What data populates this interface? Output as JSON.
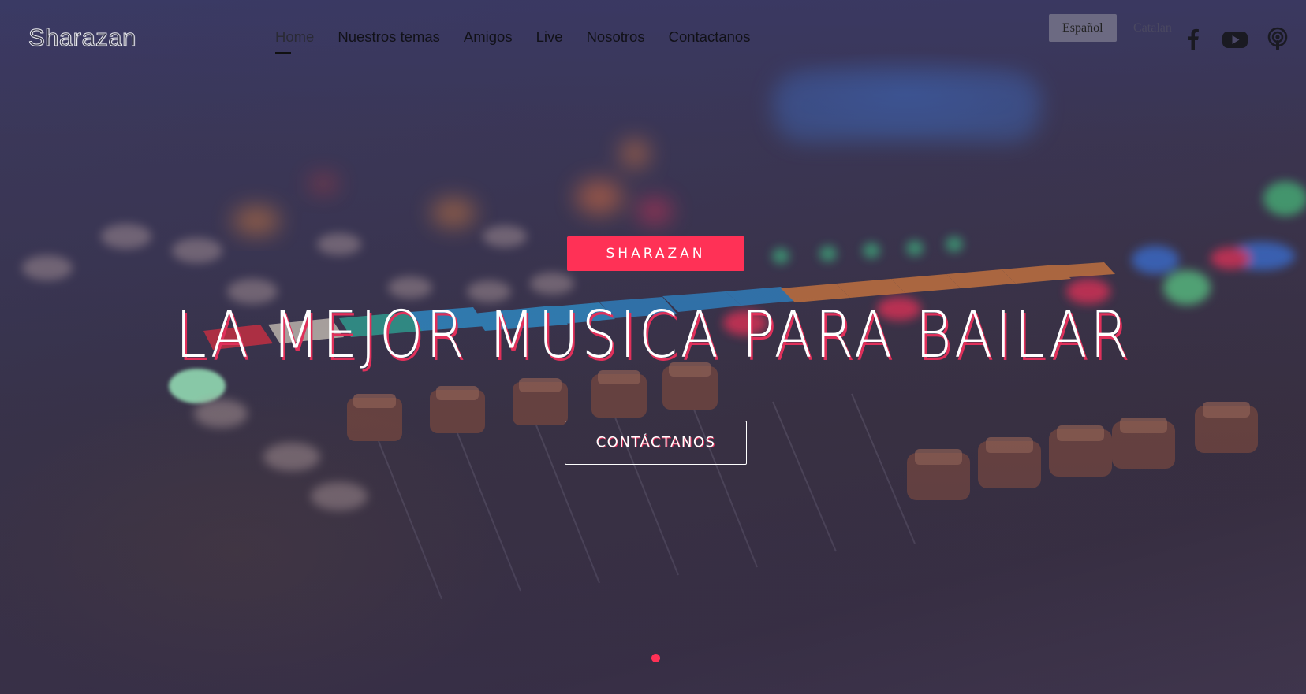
{
  "brand": {
    "name": "Sharazan"
  },
  "nav": {
    "items": [
      {
        "label": "Home",
        "active": true
      },
      {
        "label": "Nuestros temas"
      },
      {
        "label": "Amigos"
      },
      {
        "label": "Live"
      },
      {
        "label": "Nosotros"
      },
      {
        "label": "Contactanos"
      }
    ]
  },
  "language": {
    "options": [
      "Español",
      "Catalan"
    ],
    "selected": "Español"
  },
  "social": {
    "icons": [
      "facebook-icon",
      "youtube-icon",
      "podcast-icon"
    ]
  },
  "hero": {
    "badge": "SHARAZAN",
    "headline": "LA MEJOR MUSICA PARA BAILAR",
    "cta": "CONTÁCTANOS",
    "slide_indicator": {
      "current": 1,
      "total": 1
    }
  },
  "colors": {
    "accent": "#ff3156",
    "overlay": "#3a3a6e",
    "text": "#ffffff"
  }
}
